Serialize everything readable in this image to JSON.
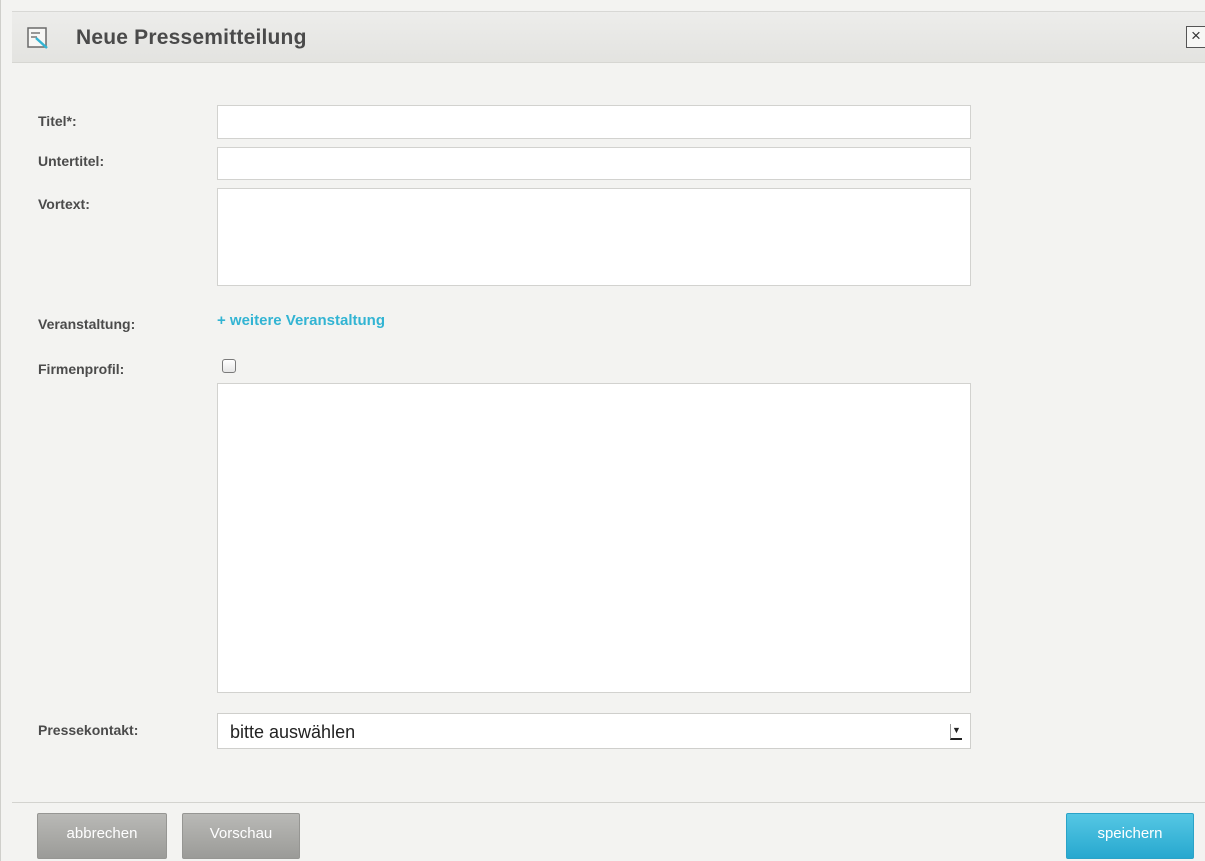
{
  "dialog": {
    "title": "Neue Pressemitteilung",
    "close_label": "×"
  },
  "form": {
    "titel_label": "Titel*:",
    "titel_value": "",
    "untertitel_label": "Untertitel:",
    "untertitel_value": "",
    "vortext_label": "Vortext:",
    "vortext_value": "",
    "veranstaltung_label": "Veranstaltung:",
    "veranstaltung_link": "+ weitere Veranstaltung",
    "firmenprofil_label": "Firmenprofil:",
    "firmenprofil_checked": false,
    "firmenprofil_value": "",
    "pressekontakt_label": "Pressekontakt:",
    "pressekontakt_value": "bitte auswählen"
  },
  "footer": {
    "cancel_label": "abbrechen",
    "preview_label": "Vorschau",
    "save_label": "speichern"
  },
  "colors": {
    "link": "#32b4d3",
    "save_button": "#2aa8cf",
    "grey_button": "#a9a9a6",
    "background": "#f3f3f1"
  }
}
